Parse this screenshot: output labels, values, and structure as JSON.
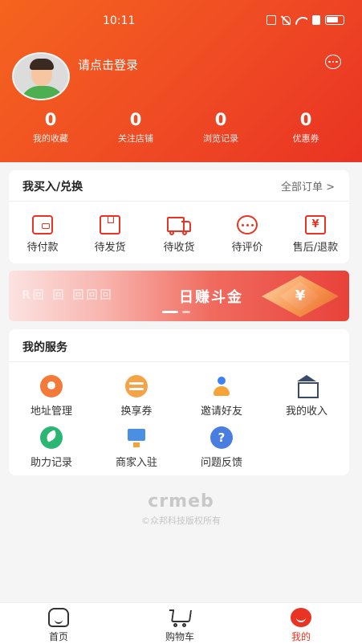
{
  "status_bar": {
    "time": "10:11"
  },
  "profile": {
    "login_prompt": "请点击登录"
  },
  "stats": [
    {
      "value": "0",
      "label": "我的收藏"
    },
    {
      "value": "0",
      "label": "关注店铺"
    },
    {
      "value": "0",
      "label": "浏览记录"
    },
    {
      "value": "0",
      "label": "优惠券"
    }
  ],
  "orders": {
    "title": "我买入/兑换",
    "all_link": "全部订单 >",
    "items": [
      {
        "label": "待付款",
        "icon": "wallet-icon"
      },
      {
        "label": "待发货",
        "icon": "package-icon"
      },
      {
        "label": "待收货",
        "icon": "truck-icon"
      },
      {
        "label": "待评价",
        "icon": "comment-icon"
      },
      {
        "label": "售后/退款",
        "icon": "refund-icon"
      }
    ]
  },
  "banner": {
    "slogan": "日赚斗金",
    "faint_text": "R回 回 回回回",
    "gem_symbol": "¥"
  },
  "services": {
    "title": "我的服务",
    "items": [
      {
        "label": "地址管理",
        "icon": "location-icon"
      },
      {
        "label": "换享券",
        "icon": "coupon-icon"
      },
      {
        "label": "邀请好友",
        "icon": "invite-icon"
      },
      {
        "label": "我的收入",
        "icon": "bank-icon"
      },
      {
        "label": "助力记录",
        "icon": "rocket-icon"
      },
      {
        "label": "商家入驻",
        "icon": "merchant-icon"
      },
      {
        "label": "问题反馈",
        "icon": "help-icon"
      }
    ]
  },
  "footer": {
    "logo": "crmeb",
    "copyright": "©众邦科技版权所有"
  },
  "tabbar": [
    {
      "label": "首页",
      "icon": "home-icon"
    },
    {
      "label": "购物车",
      "icon": "cart-icon"
    },
    {
      "label": "我的",
      "icon": "profile-icon"
    }
  ],
  "colors": {
    "accent": "#e93323",
    "header_start": "#f5641e",
    "page_bg": "#f5f5f5"
  }
}
